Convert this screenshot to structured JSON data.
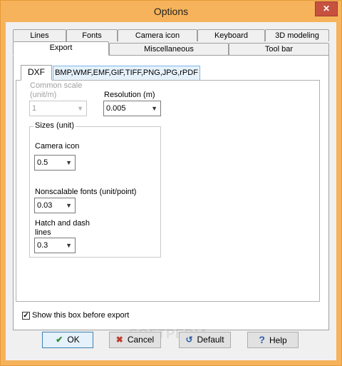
{
  "window": {
    "title": "Options",
    "close_glyph": "✕"
  },
  "tabs_row1": [
    "Lines",
    "Fonts",
    "Camera icon",
    "Keyboard",
    "3D modeling"
  ],
  "tabs_row2": [
    "Export",
    "Miscellaneous",
    "Tool bar"
  ],
  "inner_tabs": [
    "DXF",
    "BMP,WMF,EMF,GIF,TIFF,PNG,JPG,rPDF"
  ],
  "dxf": {
    "common_scale_label": "Common scale\n(unit/m)",
    "common_scale_value": "1",
    "resolution_label": "Resolution (m)",
    "resolution_value": "0.005",
    "sizes_group_label": "Sizes (unit)",
    "camera_icon_label": "Camera icon",
    "camera_icon_value": "0.5",
    "nonscalable_label": "Nonscalable fonts (unit/point)",
    "nonscalable_value": "0.03",
    "hatch_label": "Hatch and dash\nlines",
    "hatch_value": "0.3"
  },
  "show_box": {
    "label": "Show this box before export",
    "checked": true
  },
  "buttons": {
    "ok": "OK",
    "cancel": "Cancel",
    "default": "Default",
    "help": "Help"
  },
  "watermark": "SOFTPEDIA"
}
